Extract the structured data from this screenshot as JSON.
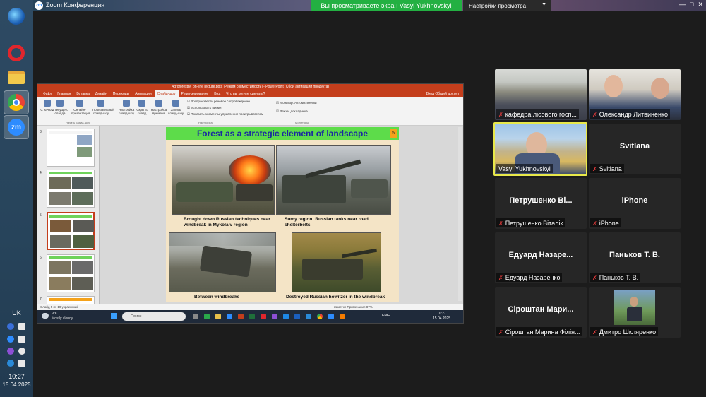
{
  "zoom": {
    "window_title": "Zoom Конференция",
    "share_banner": "Вы просматриваете экран Vasyl Yukhnovskyi",
    "view_options": "Настройки просмотра",
    "win_controls": [
      "—",
      "□",
      "✕"
    ]
  },
  "presentation": {
    "titlebar": "Agroforestry_on-line lecture.pptx [Режим совместимости] - PowerPoint (Сбой активации продукта)",
    "tabs": [
      "Файл",
      "Главная",
      "Вставка",
      "Дизайн",
      "Переходы",
      "Анимация",
      "Слайд-шоу",
      "Рецензирование",
      "Вид",
      "Что вы хотите сделать?"
    ],
    "active_tab": "Слайд-шоу",
    "tabs_right": "Вход  Общий доступ",
    "ribbon_buttons": [
      "С начала",
      "С текущего слайда",
      "Онлайн-презентация",
      "Произвольный слайд-шоу",
      "Настройка слайд-шоу",
      "Скрыть слайд",
      "Настройка времени",
      "Запись слайд-шоу"
    ],
    "ribbon_checks": [
      "Воспроизвести речевое сопровождение",
      "Использовать время",
      "Показать элементы управления проигрывателем",
      "Режим докладчика"
    ],
    "monitor_label": "Монитор: Автоматически",
    "ribbon_groups": [
      "Начать слайд-шоу",
      "Настройка",
      "Мониторы"
    ],
    "thumb_numbers": [
      "3",
      "4",
      "5",
      "6",
      "7"
    ],
    "status_left": "Слайд 5 из 10   украинский",
    "status_right": "Заметки   Примечания   87%",
    "slide": {
      "title": "Forest as a strategic element of landscape",
      "number": "5",
      "captions": [
        "Brought down Russian techniques near windbreak in Mykolaiv region",
        "Sumy region: Russian tanks near road shelterbelts",
        "Between windbreaks",
        "Destroyed Russian howitzer in the windbreak"
      ]
    },
    "inner_taskbar": {
      "weather_temp": "9°C",
      "weather_text": "Mostly cloudy",
      "search": "Поиск",
      "lang": "ENG",
      "time": "10:27",
      "date": "15.04.2025"
    }
  },
  "participants": [
    {
      "name": "кафедра лісового госп...",
      "has_video": true,
      "muted": true
    },
    {
      "name": "Олександр Литвиненко",
      "has_video": true,
      "muted": true
    },
    {
      "name": "Vasyl Yukhnovskyi",
      "has_video": true,
      "muted": false,
      "active_speaker": true
    },
    {
      "name": "Svitlana",
      "big_name": "Svitlana",
      "has_video": false,
      "muted": true
    },
    {
      "name": "Петрушенко Віталік",
      "big_name": "Петрушенко Ві...",
      "has_video": false,
      "muted": true
    },
    {
      "name": "iPhone",
      "big_name": "iPhone",
      "has_video": false,
      "muted": true
    },
    {
      "name": "Едуард Назаренко",
      "big_name": "Едуард Назаре...",
      "has_video": false,
      "muted": true
    },
    {
      "name": "Паньков Т. В.",
      "big_name": "Паньков Т. В.",
      "has_video": false,
      "muted": true
    },
    {
      "name": "Сіроштан Марина Філія...",
      "big_name": "Сіроштан Мари...",
      "has_video": false,
      "muted": true
    },
    {
      "name": "Дмитро Шкляренко",
      "has_video": true,
      "muted": true
    }
  ],
  "system_tray": {
    "lang": "UK",
    "time": "10:27",
    "date": "15.04.2025"
  }
}
